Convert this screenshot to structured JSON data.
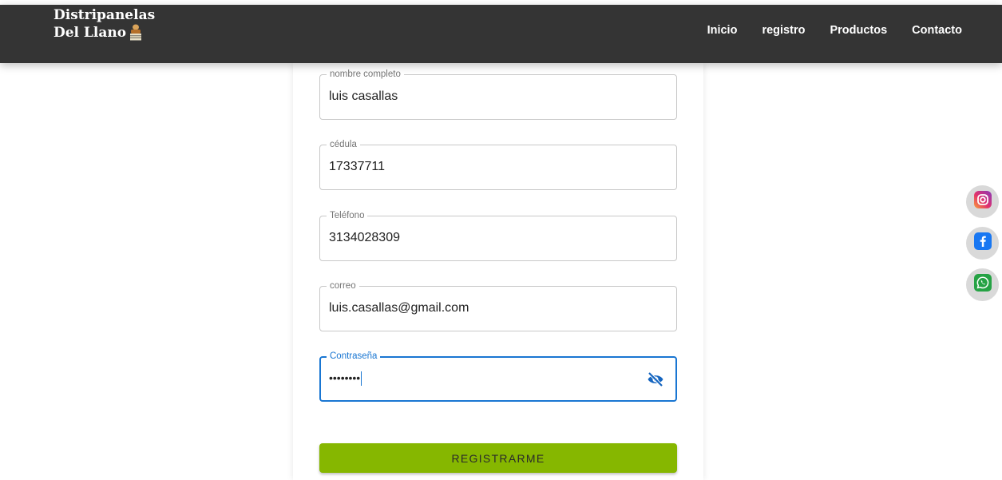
{
  "brand": {
    "line1": "Distripanelas",
    "line2": "Del Llano"
  },
  "nav": {
    "items": [
      {
        "label": "Inicio"
      },
      {
        "label": "registro"
      },
      {
        "label": "Productos"
      },
      {
        "label": "Contacto"
      }
    ]
  },
  "form": {
    "fields": [
      {
        "label": "nombre completo",
        "value": "luis casallas"
      },
      {
        "label": "cédula",
        "value": "17337711"
      },
      {
        "label": "Teléfono",
        "value": "3134028309"
      },
      {
        "label": "correo",
        "value": "luis.casallas@gmail.com"
      },
      {
        "label": "Contraseña",
        "value": "••••••••"
      }
    ],
    "submit_label": "REGISTRARME"
  },
  "social": [
    {
      "icon": "instagram-icon"
    },
    {
      "icon": "facebook-icon"
    },
    {
      "icon": "whatsapp-icon"
    }
  ],
  "colors": {
    "navbar": "#343434",
    "accent_focus": "#1976d2",
    "submit_button": "#86b700"
  }
}
